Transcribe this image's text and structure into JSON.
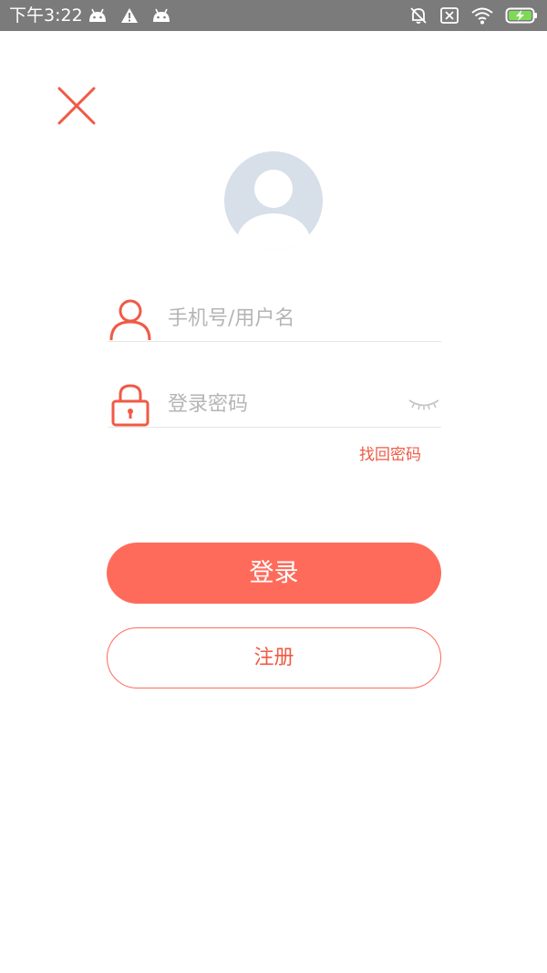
{
  "status_bar": {
    "time": "下午3:22",
    "left_icons": [
      "android-icon",
      "warning-icon",
      "android-icon"
    ],
    "right_icons": [
      "alarm-off-icon",
      "sim-off-icon",
      "wifi-icon",
      "battery-charging-icon"
    ]
  },
  "colors": {
    "accent": "#ff6b5b",
    "accent_text": "#f05a45",
    "avatar_bg": "#d7dfe9",
    "status_bar_bg": "#7b7b7b"
  },
  "login_form": {
    "username_placeholder": "手机号/用户名",
    "password_placeholder": "登录密码",
    "forgot_password_label": "找回密码",
    "login_label": "登录",
    "register_label": "注册"
  }
}
